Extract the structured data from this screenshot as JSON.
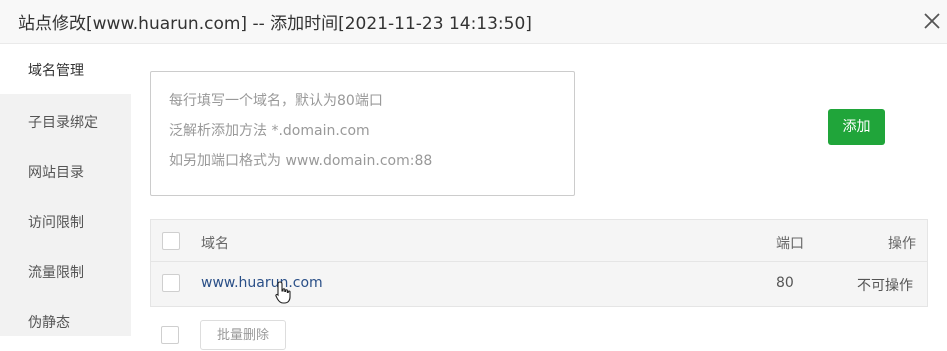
{
  "dialog": {
    "title": "站点修改[www.huarun.com] -- 添加时间[2021-11-23 14:13:50]",
    "close_icon": "close-icon"
  },
  "sidebar": {
    "items": [
      {
        "label": "域名管理",
        "active": true
      },
      {
        "label": "子目录绑定",
        "active": false
      },
      {
        "label": "网站目录",
        "active": false
      },
      {
        "label": "访问限制",
        "active": false
      },
      {
        "label": "流量限制",
        "active": false
      },
      {
        "label": "伪静态",
        "active": false
      }
    ]
  },
  "domain_input": {
    "placeholder_lines": [
      "每行填写一个域名，默认为80端口",
      "泛解析添加方法 *.domain.com",
      "如另加端口格式为 www.domain.com:88"
    ],
    "value": ""
  },
  "add_button": {
    "label": "添加",
    "color": "#20a53a"
  },
  "table": {
    "headers": {
      "domain": "域名",
      "port": "端口",
      "action": "操作"
    },
    "rows": [
      {
        "domain": "www.huarun.com",
        "port": "80",
        "action": "不可操作"
      }
    ]
  },
  "batch_delete": {
    "label": "批量删除"
  }
}
